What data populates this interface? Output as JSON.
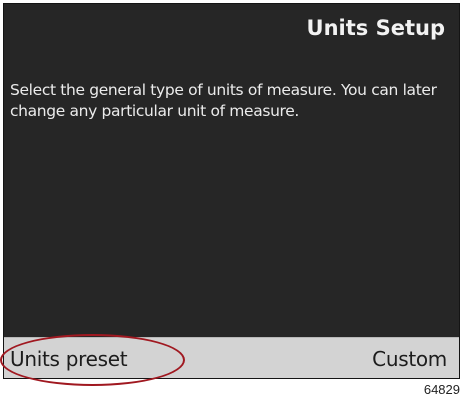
{
  "screen": {
    "title": "Units Setup",
    "description": "Select the general type of units of measure. You can later change any particular unit of measure."
  },
  "softkeys": {
    "left_label": "Units preset",
    "right_label": "Custom"
  },
  "callout": {
    "color": "#a01820",
    "target": "Units preset"
  },
  "figure": {
    "number": "64829"
  },
  "colors": {
    "screen_background": "#262626",
    "softkey_bar": "#d3d3d3",
    "screen_text": "#f2f2f2"
  }
}
